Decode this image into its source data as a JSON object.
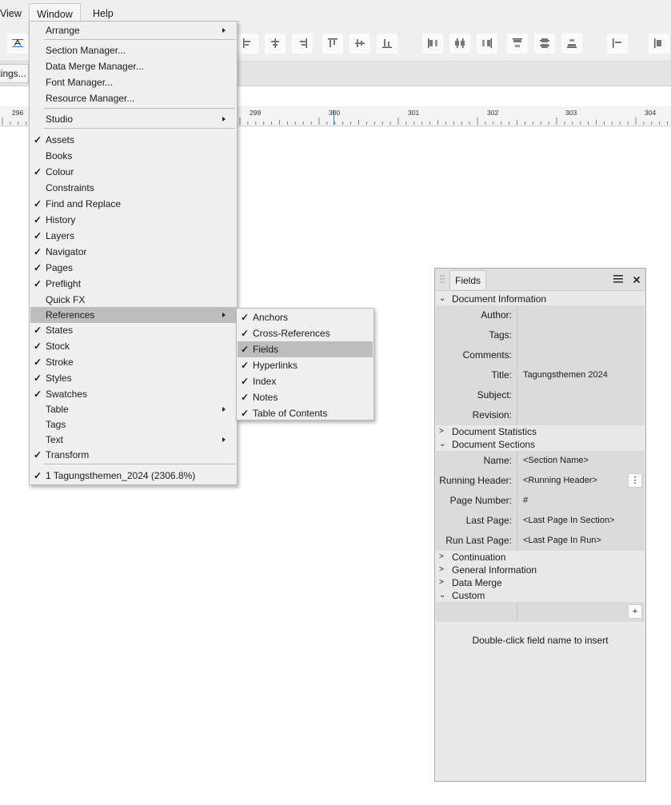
{
  "menubar": {
    "view": "View",
    "window": "Window",
    "help": "Help"
  },
  "context_bar": {
    "chip_text": "ttings..."
  },
  "ruler": {
    "labels": [
      "296",
      "299",
      "300",
      "301",
      "302",
      "303",
      "304"
    ],
    "current": "300"
  },
  "window_menu": {
    "items": [
      {
        "label": "Arrange",
        "submenu": true
      },
      {
        "label": "Section Manager..."
      },
      {
        "label": "Data Merge Manager..."
      },
      {
        "label": "Font Manager..."
      },
      {
        "label": "Resource Manager..."
      },
      {
        "label": "Studio",
        "submenu": true
      },
      {
        "label": "Assets",
        "checked": true
      },
      {
        "label": "Books"
      },
      {
        "label": "Colour",
        "checked": true
      },
      {
        "label": "Constraints"
      },
      {
        "label": "Find and Replace",
        "checked": true
      },
      {
        "label": "History",
        "checked": true
      },
      {
        "label": "Layers",
        "checked": true
      },
      {
        "label": "Navigator",
        "checked": true
      },
      {
        "label": "Pages",
        "checked": true
      },
      {
        "label": "Preflight",
        "checked": true
      },
      {
        "label": "Quick FX"
      },
      {
        "label": "References",
        "submenu": true,
        "highlighted": true
      },
      {
        "label": "States",
        "checked": true
      },
      {
        "label": "Stock",
        "checked": true
      },
      {
        "label": "Stroke",
        "checked": true
      },
      {
        "label": "Styles",
        "checked": true
      },
      {
        "label": "Swatches",
        "checked": true
      },
      {
        "label": "Table",
        "submenu": true
      },
      {
        "label": "Tags"
      },
      {
        "label": "Text",
        "submenu": true
      },
      {
        "label": "Transform",
        "checked": true
      },
      {
        "label": "1 Tagungsthemen_2024 (2306.8%)",
        "checked": true
      }
    ]
  },
  "references_submenu": {
    "items": [
      {
        "label": "Anchors",
        "checked": true
      },
      {
        "label": "Cross-References",
        "checked": true
      },
      {
        "label": "Fields",
        "checked": true,
        "highlighted": true
      },
      {
        "label": "Hyperlinks",
        "checked": true
      },
      {
        "label": "Index",
        "checked": true
      },
      {
        "label": "Notes",
        "checked": true
      },
      {
        "label": "Table of Contents",
        "checked": true
      }
    ]
  },
  "fields_panel": {
    "tab": "Fields",
    "sections": {
      "doc_info": "Document Information",
      "doc_stats": "Document Statistics",
      "doc_sections": "Document Sections",
      "continuation": "Continuation",
      "general_info": "General Information",
      "data_merge": "Data Merge",
      "custom": "Custom"
    },
    "doc_info_rows": [
      {
        "key": "Author:",
        "value": ""
      },
      {
        "key": "Tags:",
        "value": ""
      },
      {
        "key": "Comments:",
        "value": ""
      },
      {
        "key": "Title:",
        "value": "Tagungsthemen 2024"
      },
      {
        "key": "Subject:",
        "value": ""
      },
      {
        "key": "Revision:",
        "value": ""
      }
    ],
    "doc_section_rows": [
      {
        "key": "Name:",
        "value": "<Section Name>"
      },
      {
        "key": "Running Header:",
        "value": "<Running Header>"
      },
      {
        "key": "Page Number:",
        "value": "#"
      },
      {
        "key": "Last Page:",
        "value": "<Last Page In Section>"
      },
      {
        "key": "Run Last Page:",
        "value": "<Last Page In Run>"
      }
    ],
    "hint": "Double-click field name to insert"
  }
}
